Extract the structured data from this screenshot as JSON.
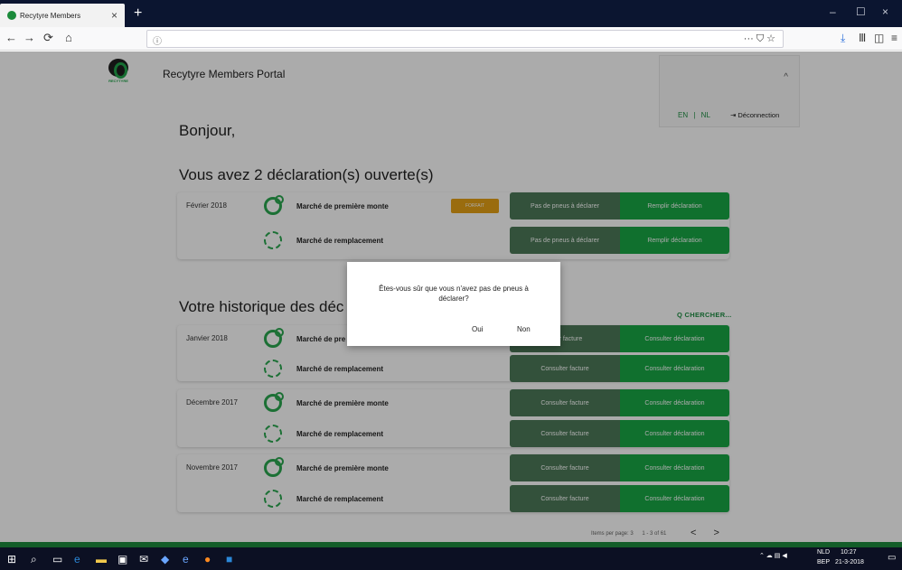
{
  "browser": {
    "tab_title": "Recytyre Members",
    "tab_close": "×",
    "new_tab": "+",
    "win_min": "–",
    "win_max": "☐",
    "win_close": "×",
    "back": "←",
    "forward": "→",
    "reload": "⟳",
    "home": "⌂",
    "url_info": "ⓘ",
    "url_icons": "··· ⛉ ☆",
    "downloads": "⤓",
    "library": "Ⅲ",
    "sidebar": "◫",
    "menu": "≡"
  },
  "header": {
    "logo_word": "RECYTYRE",
    "portal_title": "Recytyre Members Portal",
    "lang_en": "EN",
    "lang_sep": "|",
    "lang_nl": "NL",
    "logout": "Déconnection",
    "chevron": "^"
  },
  "greeting": "Bonjour,",
  "open_section_title": "Vous avez 2 déclaration(s) ouverte(s)",
  "open_declarations": {
    "period": "Février 2018",
    "rows": [
      {
        "market": "Marché de première monte",
        "badge": "FORFAIT",
        "btn_grey": "Pas de pneus à déclarer",
        "btn_green": "Remplir déclaration"
      },
      {
        "market": "Marché de remplacement",
        "btn_grey": "Pas de pneus à déclarer",
        "btn_green": "Remplir déclaration"
      }
    ]
  },
  "history_section_title": "Votre historique des déc",
  "search_label": "Q CHERCHER...",
  "history": [
    {
      "period": "Janvier 2018",
      "rows": [
        {
          "market": "Marché de pre",
          "btn_grey": "…ter facture",
          "btn_green": "Consulter déclaration"
        },
        {
          "market": "Marché de remplacement",
          "btn_grey": "Consulter facture",
          "btn_green": "Consulter déclaration"
        }
      ]
    },
    {
      "period": "Décembre 2017",
      "rows": [
        {
          "market": "Marché de première monte",
          "btn_grey": "Consulter facture",
          "btn_green": "Consulter déclaration"
        },
        {
          "market": "Marché de remplacement",
          "btn_grey": "Consulter facture",
          "btn_green": "Consulter déclaration"
        }
      ]
    },
    {
      "period": "Novembre 2017",
      "rows": [
        {
          "market": "Marché de première monte",
          "btn_grey": "Consulter facture",
          "btn_green": "Consulter déclaration"
        },
        {
          "market": "Marché de remplacement",
          "btn_grey": "Consulter facture",
          "btn_green": "Consulter déclaration"
        }
      ]
    }
  ],
  "pager": {
    "items_per_page": "Items per page: 3",
    "range": "1 - 3 of 61",
    "prev": "<",
    "next": ">"
  },
  "dialog": {
    "message": "Êtes-vous sûr que vous n'avez pas de pneus à déclarer?",
    "yes": "Oui",
    "no": "Non"
  },
  "taskbar": {
    "lang": "NLD",
    "region": "BEP",
    "time": "10:27",
    "date": "21-3-2018"
  },
  "colors": {
    "brand_green": "#18a745",
    "muted_green": "#4c7a58",
    "badge_orange": "#e6a116"
  }
}
